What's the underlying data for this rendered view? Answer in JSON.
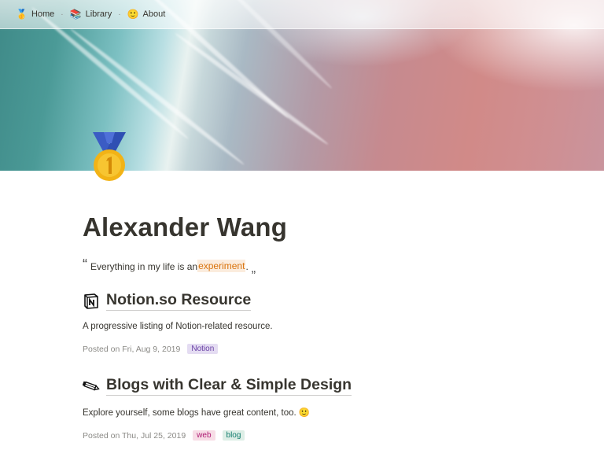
{
  "nav": {
    "items": [
      {
        "icon": "medal-icon",
        "glyph": "🥇",
        "label": "Home"
      },
      {
        "icon": "books-icon",
        "glyph": "📚",
        "label": "Library"
      },
      {
        "icon": "smile-icon",
        "glyph": "🙂",
        "label": "About"
      }
    ],
    "separator": "·"
  },
  "page": {
    "title": "Alexander Wang",
    "quote": {
      "open_mark": "“",
      "before": "Everything in my life is an ",
      "highlight": "experiment",
      "after": ".",
      "close_mark": "„"
    }
  },
  "posts": [
    {
      "icon": "notion-logo-icon",
      "title": "Notion.so Resource",
      "description": "A progressive listing of Notion-related resource.",
      "meta": "Posted on Fri, Aug 9, 2019",
      "tags": [
        "Notion"
      ]
    },
    {
      "icon": "pencil-icon",
      "title": "Blogs with Clear & Simple Design",
      "description": "Explore yourself, some blogs have great content, too. 🙂",
      "meta": "Posted on Thu, Jul 25, 2019",
      "tags": [
        "web",
        "blog"
      ]
    }
  ],
  "colors": {
    "text": "#37352f",
    "muted": "#8b8a86",
    "highlight_bg": "#fbecdd",
    "highlight_text": "#d9730d"
  }
}
